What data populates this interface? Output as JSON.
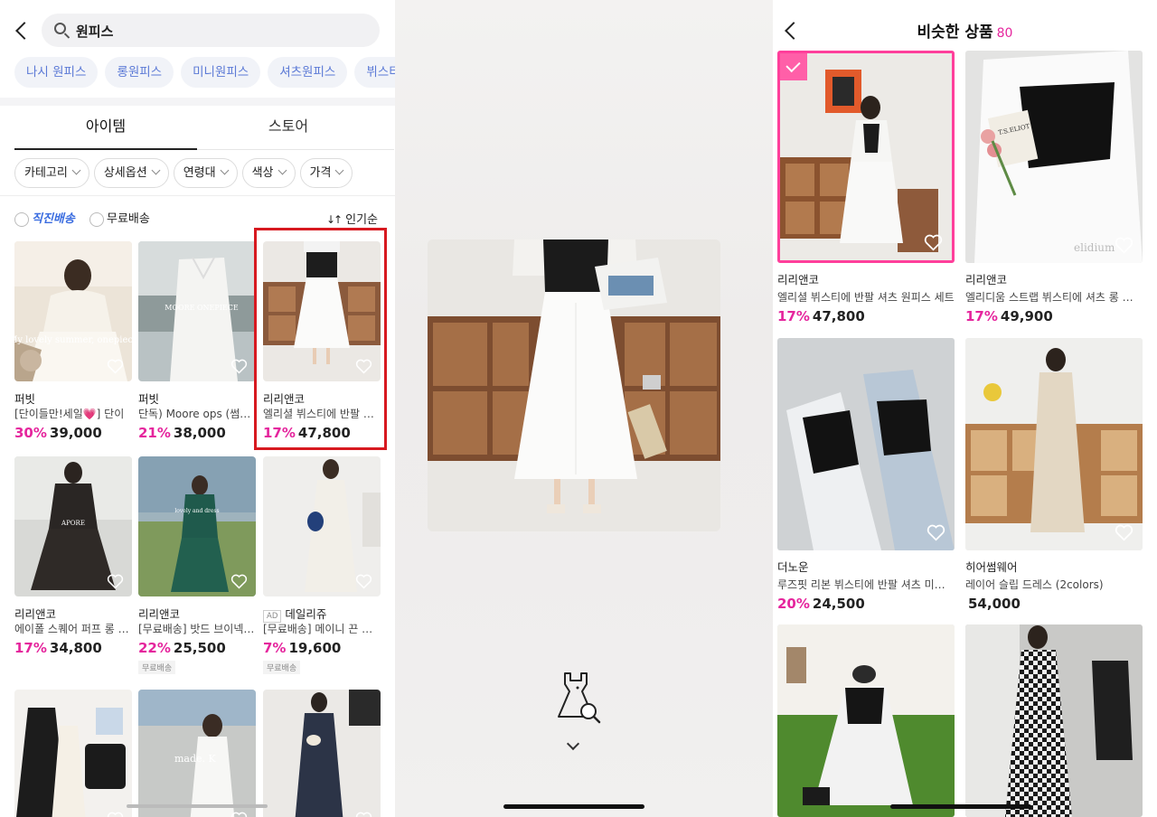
{
  "search": {
    "query": "원피스"
  },
  "chips": [
    "나시 원피스",
    "롱원피스",
    "미니원피스",
    "셔츠원피스",
    "뷔스티에 원"
  ],
  "tabs": [
    {
      "label": "아이템"
    },
    {
      "label": "스토어"
    }
  ],
  "filters": [
    "카테고리",
    "상세옵션",
    "연령대",
    "색상",
    "가격"
  ],
  "options": {
    "direct_shipping": "직진배송",
    "free_shipping": "무료배송",
    "sort": "인기순"
  },
  "products": [
    {
      "brand": "퍼빗",
      "name": "[단이들만!세일💗] 단이",
      "discount": "30%",
      "price": "39,000",
      "img_text": "My lovely summer, onepiece"
    },
    {
      "brand": "퍼빗",
      "name": "단독) Moore ops (썸머 원피스",
      "discount": "21%",
      "price": "38,000",
      "img_text": "MOORE ONEPIECE"
    },
    {
      "brand": "리리앤코",
      "name": "엘리셜 뷔스티에 반팔 셔츠 원피스",
      "discount": "17%",
      "price": "47,800"
    },
    {
      "brand": "리리앤코",
      "name": "에이폴 스퀘어 퍼프 롱 원피스",
      "discount": "17%",
      "price": "34,800",
      "img_text": "APORE"
    },
    {
      "brand": "리리앤코",
      "name": "[무료배송] 밧드 브이넥 롱",
      "discount": "22%",
      "price": "25,500",
      "tag": "무료배송",
      "img_text": "lovely and dress"
    },
    {
      "brand": "데일리쥬",
      "name": "[무료배송] 메이니 끈 롱 원피스",
      "discount": "7%",
      "price": "19,600",
      "tag": "무료배송",
      "ad": "AD"
    },
    {
      "brand": "",
      "name": "",
      "discount": "",
      "price": ""
    },
    {
      "brand": "",
      "name": "",
      "discount": "",
      "price": "",
      "img_text": "made. K"
    },
    {
      "brand": "",
      "name": "",
      "discount": "",
      "price": ""
    }
  ],
  "similar": {
    "title": "비슷한 상품",
    "count": "80",
    "items": [
      {
        "brand": "리리앤코",
        "name": "엘리셜 뷔스티에 반팔 셔츠 원피스 세트",
        "discount": "17%",
        "price": "47,800",
        "selected": true
      },
      {
        "brand": "리리앤코",
        "name": "엘리디움 스트랩 뷔스티에 셔츠 롱 원피스",
        "discount": "17%",
        "price": "49,900",
        "img_text": "elidium",
        "book_text": "T.S.ELIOT"
      },
      {
        "brand": "더노운",
        "name": "루즈핏 리본 뷔스티에 반팔 셔츠 미디 원피스",
        "discount": "20%",
        "price": "24,500"
      },
      {
        "brand": "히어썸웨어",
        "name": "레이어 슬립 드레스 (2colors)",
        "discount": "",
        "price": "54,000"
      },
      {
        "brand": "",
        "name": "",
        "discount": "",
        "price": ""
      },
      {
        "brand": "",
        "name": "",
        "discount": "",
        "price": ""
      }
    ]
  },
  "colors": {
    "accent_pink": "#e5259d",
    "link_blue": "#5c7ad6",
    "highlight_red": "#d71920"
  }
}
